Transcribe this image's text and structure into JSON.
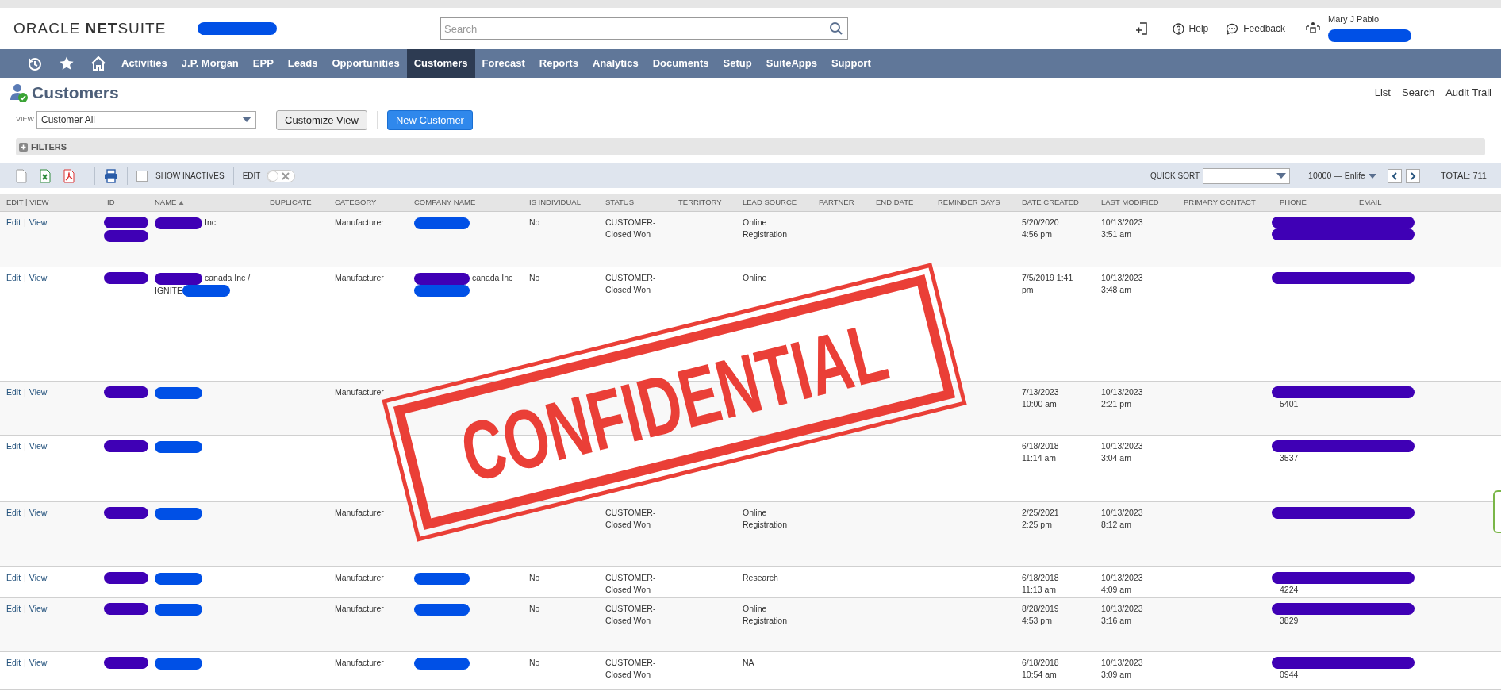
{
  "header": {
    "logo": "ORACLE **NET**SUITE",
    "search": {
      "placeholder": "Search"
    },
    "actions": [
      {
        "kind": "help",
        "label": "Help"
      },
      {
        "kind": "feedback",
        "label": "Feedback"
      }
    ],
    "user": {
      "name": "Mary J Pablo"
    }
  },
  "nav": {
    "items": [
      {
        "label": "Activities",
        "selected": false
      },
      {
        "label": "J.P. Morgan",
        "selected": false
      },
      {
        "label": "EPP",
        "selected": false
      },
      {
        "label": "Leads",
        "selected": false
      },
      {
        "label": "Opportunities",
        "selected": false
      },
      {
        "label": "Customers",
        "selected": true
      },
      {
        "label": "Forecast",
        "selected": false
      },
      {
        "label": "Reports",
        "selected": false
      },
      {
        "label": "Analytics",
        "selected": false
      },
      {
        "label": "Documents",
        "selected": false
      },
      {
        "label": "Setup",
        "selected": false
      },
      {
        "label": "SuiteApps",
        "selected": false
      },
      {
        "label": "Support",
        "selected": false
      }
    ]
  },
  "page": {
    "title": "Customers",
    "links": [
      "List",
      "Search",
      "Audit Trail"
    ]
  },
  "view": {
    "label": "VIEW",
    "value": "Customer All",
    "buttons": [
      {
        "label": "Customize View",
        "kind": "secondary"
      },
      {
        "label": "New Customer",
        "kind": "primary"
      }
    ]
  },
  "filters": {
    "label": "FILTERS"
  },
  "toolbar": {
    "show_inactives": {
      "label": "SHOW INACTIVES",
      "checked": false
    },
    "edit": {
      "label": "EDIT",
      "on": false
    },
    "quick_sort": {
      "label": "QUICK SORT"
    },
    "range": "10000 — Enlife",
    "total": "TOTAL: 711"
  },
  "table": {
    "columns": [
      "EDIT | VIEW",
      "ID",
      "NAME",
      "DUPLICATE",
      "CATEGORY",
      "COMPANY NAME",
      "IS INDIVIDUAL",
      "STATUS",
      "TERRITORY",
      "LEAD SOURCE",
      "PARTNER",
      "END DATE",
      "REMINDER DAYS",
      "DATE CREATED",
      "LAST MODIFIED",
      "PRIMARY CONTACT",
      "PHONE",
      "EMAIL"
    ],
    "rows": [
      {
        "cells": [
          [
            {
              "kind": "link",
              "text": "Edit"
            },
            {
              "kind": "separator",
              "text": "|"
            },
            {
              "kind": "link",
              "text": "View"
            }
          ],
          [
            {
              "kind": "redaction",
              "color": "#3f00b5"
            },
            {
              "kind": "redaction",
              "color": "#3f00b5"
            }
          ],
          [
            {
              "kind": "redaction",
              "color": "#3f00b5"
            },
            {
              "kind": "text",
              "text": "Inc."
            }
          ],
          "",
          "Manufacturer",
          [
            {
              "kind": "redaction",
              "color": "#0050e6"
            }
          ],
          "No",
          "CUSTOMER-Closed Won",
          "",
          "Online Registration",
          "",
          "",
          "",
          "5/20/2020 4:56 pm",
          "10/13/2023 3:51 am",
          "",
          [
            {
              "kind": "redaction",
              "color": "#3f00b5"
            },
            {
              "kind": "redaction",
              "color": "#3f00b5"
            }
          ],
          ""
        ]
      },
      {
        "cells": [
          [
            {
              "kind": "link",
              "text": "Edit"
            },
            {
              "kind": "separator",
              "text": "|"
            },
            {
              "kind": "link",
              "text": "View"
            }
          ],
          [
            {
              "kind": "redaction",
              "color": "#3f00b5"
            }
          ],
          [
            {
              "kind": "redaction",
              "color": "#3f00b5"
            },
            {
              "kind": "text",
              "text": "canada Inc / IGNITE"
            },
            {
              "kind": "redaction",
              "color": "#0050e6"
            }
          ],
          "",
          "Manufacturer",
          [
            {
              "kind": "redaction",
              "color": "#3f00b5"
            },
            {
              "kind": "text",
              "text": "canada Inc"
            },
            {
              "kind": "redaction",
              "color": "#0050e6"
            }
          ],
          "No",
          "CUSTOMER-Closed Won",
          "",
          "Online",
          "",
          "",
          "",
          "7/5/2019 1:41 pm",
          "10/13/2023 3:48 am",
          "",
          [
            {
              "kind": "redaction",
              "color": "#3f00b5"
            }
          ],
          ""
        ]
      },
      {
        "cells": [
          [
            {
              "kind": "link",
              "text": "Edit"
            },
            {
              "kind": "separator",
              "text": "|"
            },
            {
              "kind": "link",
              "text": "View"
            }
          ],
          [
            {
              "kind": "redaction",
              "color": "#3f00b5"
            }
          ],
          [
            {
              "kind": "redaction",
              "color": "#0050e6"
            }
          ],
          "",
          "Manufacturer",
          "",
          "",
          "",
          "",
          "",
          "",
          "",
          "",
          "7/13/2023 10:00 am",
          "10/13/2023 2:21 pm",
          "",
          [
            {
              "kind": "redaction",
              "color": "#3f00b5"
            },
            {
              "kind": "text",
              "text": "5401"
            }
          ],
          ""
        ]
      },
      {
        "cells": [
          [
            {
              "kind": "link",
              "text": "Edit"
            },
            {
              "kind": "separator",
              "text": "|"
            },
            {
              "kind": "link",
              "text": "View"
            }
          ],
          [
            {
              "kind": "redaction",
              "color": "#3f00b5"
            }
          ],
          [
            {
              "kind": "redaction",
              "color": "#0050e6"
            }
          ],
          "",
          "",
          "",
          "",
          "",
          "",
          "",
          "",
          "",
          "",
          "6/18/2018 11:14 am",
          "10/13/2023 3:04 am",
          "",
          [
            {
              "kind": "redaction",
              "color": "#3f00b5"
            },
            {
              "kind": "text",
              "text": "3537"
            }
          ],
          ""
        ]
      },
      {
        "cells": [
          [
            {
              "kind": "link",
              "text": "Edit"
            },
            {
              "kind": "separator",
              "text": "|"
            },
            {
              "kind": "link",
              "text": "View"
            }
          ],
          [
            {
              "kind": "redaction",
              "color": "#3f00b5"
            }
          ],
          [
            {
              "kind": "redaction",
              "color": "#0050e6"
            }
          ],
          "",
          "Manufacturer",
          "",
          "",
          "CUSTOMER-Closed Won",
          "",
          "Online Registration",
          "",
          "",
          "",
          "2/25/2021 2:25 pm",
          "10/13/2023 8:12 am",
          "",
          [
            {
              "kind": "redaction",
              "color": "#3f00b5"
            }
          ],
          ""
        ]
      },
      {
        "cells": [
          [
            {
              "kind": "link",
              "text": "Edit"
            },
            {
              "kind": "separator",
              "text": "|"
            },
            {
              "kind": "link",
              "text": "View"
            }
          ],
          [
            {
              "kind": "redaction",
              "color": "#3f00b5"
            }
          ],
          [
            {
              "kind": "redaction",
              "color": "#0050e6"
            }
          ],
          "",
          "Manufacturer",
          [
            {
              "kind": "redaction",
              "color": "#0050e6"
            }
          ],
          "No",
          "CUSTOMER-Closed Won",
          "",
          "Research",
          "",
          "",
          "",
          "6/18/2018 11:13 am",
          "10/13/2023 4:09 am",
          "",
          [
            {
              "kind": "redaction",
              "color": "#3f00b5"
            },
            {
              "kind": "text",
              "text": "4224"
            }
          ],
          ""
        ]
      },
      {
        "cells": [
          [
            {
              "kind": "link",
              "text": "Edit"
            },
            {
              "kind": "separator",
              "text": "|"
            },
            {
              "kind": "link",
              "text": "View"
            }
          ],
          [
            {
              "kind": "redaction",
              "color": "#3f00b5"
            }
          ],
          [
            {
              "kind": "redaction",
              "color": "#0050e6"
            }
          ],
          "",
          "Manufacturer",
          [
            {
              "kind": "redaction",
              "color": "#0050e6"
            }
          ],
          "No",
          "CUSTOMER-Closed Won",
          "",
          "Online Registration",
          "",
          "",
          "",
          "8/28/2019 4:53 pm",
          "10/13/2023 3:16 am",
          "",
          [
            {
              "kind": "redaction",
              "color": "#3f00b5"
            },
            {
              "kind": "text",
              "text": "3829"
            }
          ],
          ""
        ]
      },
      {
        "cells": [
          [
            {
              "kind": "link",
              "text": "Edit"
            },
            {
              "kind": "separator",
              "text": "|"
            },
            {
              "kind": "link",
              "text": "View"
            }
          ],
          [
            {
              "kind": "redaction",
              "color": "#3f00b5"
            }
          ],
          [
            {
              "kind": "redaction",
              "color": "#0050e6"
            }
          ],
          "",
          "Manufacturer",
          [
            {
              "kind": "redaction",
              "color": "#0050e6"
            }
          ],
          "No",
          "CUSTOMER-Closed Won",
          "",
          "NA",
          "",
          "",
          "",
          "6/18/2018 10:54 am",
          "10/13/2023 3:09 am",
          "",
          [
            {
              "kind": "redaction",
              "color": "#3f00b5"
            },
            {
              "kind": "text",
              "text": "0944"
            }
          ],
          ""
        ]
      }
    ]
  },
  "stamp": {
    "text": "CONFIDENTIAL"
  }
}
